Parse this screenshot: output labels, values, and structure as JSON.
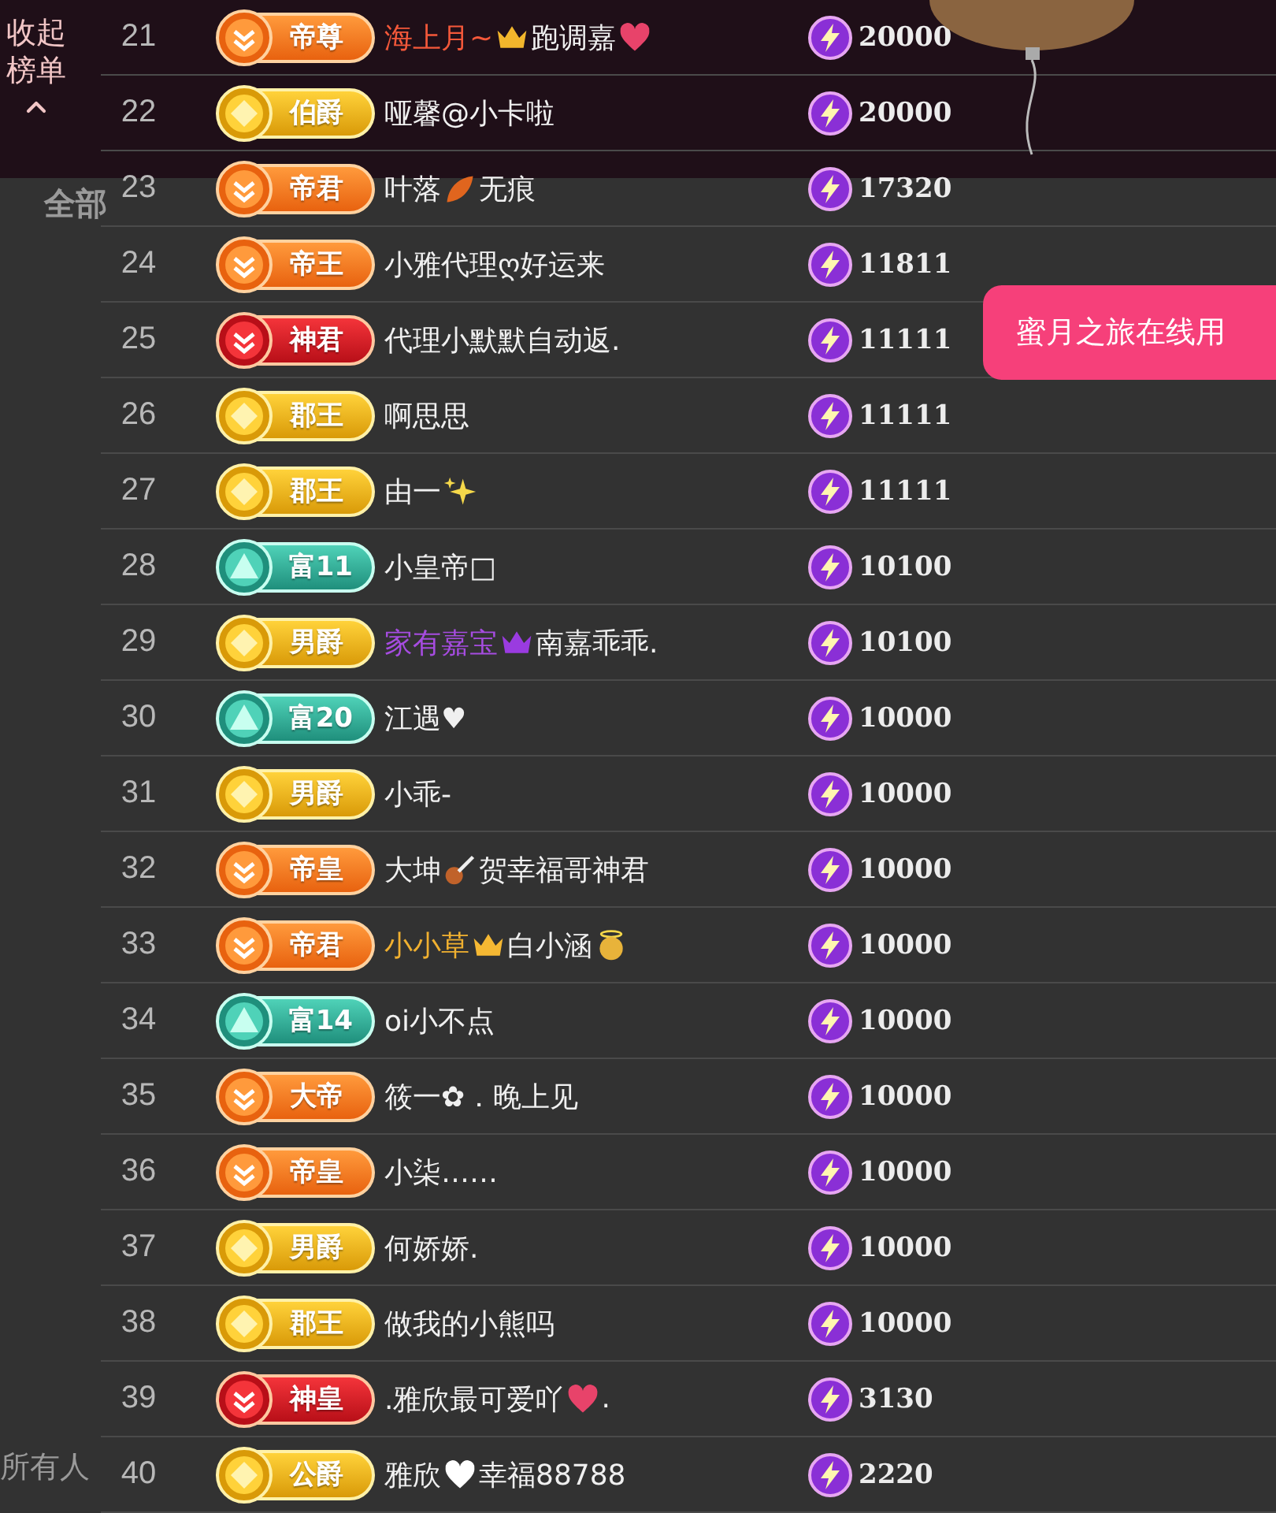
{
  "collapse_button": {
    "label": "收起榜单"
  },
  "background_tab": {
    "label": "全部"
  },
  "background_input": {
    "label": "所有人"
  },
  "toast": {
    "text": "蜜月之旅在线用"
  },
  "rows": [
    {
      "rank": "21",
      "badge": {
        "kind": "orange",
        "label": "帝尊"
      },
      "name": [
        {
          "kind": "text",
          "text": "海上月~",
          "color": "#f4583a"
        },
        {
          "kind": "crown",
          "color": "#f2b62c"
        },
        {
          "kind": "text",
          "text": "跑调嘉"
        },
        {
          "kind": "heart",
          "color": "#e8436a"
        }
      ],
      "score": "20000"
    },
    {
      "rank": "22",
      "badge": {
        "kind": "gold",
        "label": "伯爵"
      },
      "name": [
        {
          "kind": "text",
          "text": "哑馨@小卡啦"
        }
      ],
      "score": "20000"
    },
    {
      "rank": "23",
      "badge": {
        "kind": "orange",
        "label": "帝君"
      },
      "name": [
        {
          "kind": "text",
          "text": "叶落"
        },
        {
          "kind": "leaf",
          "color": "#e0651e"
        },
        {
          "kind": "text",
          "text": "无痕"
        }
      ],
      "score": "17320"
    },
    {
      "rank": "24",
      "badge": {
        "kind": "orange",
        "label": "帝王"
      },
      "name": [
        {
          "kind": "text",
          "text": "小雅代理ღ好运来"
        }
      ],
      "score": "11811"
    },
    {
      "rank": "25",
      "badge": {
        "kind": "red",
        "label": "神君"
      },
      "name": [
        {
          "kind": "text",
          "text": "代理小默默自动返."
        }
      ],
      "score": "11111"
    },
    {
      "rank": "26",
      "badge": {
        "kind": "gold",
        "label": "郡王"
      },
      "name": [
        {
          "kind": "text",
          "text": "啊思思"
        }
      ],
      "score": "11111"
    },
    {
      "rank": "27",
      "badge": {
        "kind": "gold",
        "label": "郡王"
      },
      "name": [
        {
          "kind": "text",
          "text": "由一"
        },
        {
          "kind": "sparkles",
          "color": "#f5d84a"
        }
      ],
      "score": "11111"
    },
    {
      "rank": "28",
      "badge": {
        "kind": "teal",
        "label": "富11"
      },
      "name": [
        {
          "kind": "text",
          "text": "小皇帝□"
        }
      ],
      "score": "10100"
    },
    {
      "rank": "29",
      "badge": {
        "kind": "gold",
        "label": "男爵"
      },
      "name": [
        {
          "kind": "text",
          "text": "家有嘉宝",
          "color": "#a64ce0"
        },
        {
          "kind": "crown",
          "color": "#9a3be0"
        },
        {
          "kind": "text",
          "text": "南嘉乖乖."
        }
      ],
      "score": "10100"
    },
    {
      "rank": "30",
      "badge": {
        "kind": "teal",
        "label": "富20"
      },
      "name": [
        {
          "kind": "text",
          "text": "江遇♥"
        }
      ],
      "score": "10000"
    },
    {
      "rank": "31",
      "badge": {
        "kind": "gold",
        "label": "男爵"
      },
      "name": [
        {
          "kind": "text",
          "text": "小乖-"
        }
      ],
      "score": "10000"
    },
    {
      "rank": "32",
      "badge": {
        "kind": "orange",
        "label": "帝皇"
      },
      "name": [
        {
          "kind": "text",
          "text": "大坤"
        },
        {
          "kind": "guitar",
          "color": "#c0622a"
        },
        {
          "kind": "text",
          "text": "贺幸福哥神君"
        }
      ],
      "score": "10000"
    },
    {
      "rank": "33",
      "badge": {
        "kind": "orange",
        "label": "帝君"
      },
      "name": [
        {
          "kind": "text",
          "text": "小小草",
          "color": "#f0b030"
        },
        {
          "kind": "crown",
          "color": "#f5b833"
        },
        {
          "kind": "text",
          "text": "白小涵"
        },
        {
          "kind": "angel",
          "color": "#e8b33a"
        }
      ],
      "score": "10000"
    },
    {
      "rank": "34",
      "badge": {
        "kind": "teal",
        "label": "富14"
      },
      "name": [
        {
          "kind": "text",
          "text": "oi小不点"
        }
      ],
      "score": "10000"
    },
    {
      "rank": "35",
      "badge": {
        "kind": "orange",
        "label": "大帝"
      },
      "name": [
        {
          "kind": "text",
          "text": "筱一✿．晚上见"
        }
      ],
      "score": "10000"
    },
    {
      "rank": "36",
      "badge": {
        "kind": "orange",
        "label": "帝皇"
      },
      "name": [
        {
          "kind": "text",
          "text": "小柒……"
        }
      ],
      "score": "10000"
    },
    {
      "rank": "37",
      "badge": {
        "kind": "gold",
        "label": "男爵"
      },
      "name": [
        {
          "kind": "text",
          "text": "何娇娇."
        }
      ],
      "score": "10000"
    },
    {
      "rank": "38",
      "badge": {
        "kind": "gold",
        "label": "郡王"
      },
      "name": [
        {
          "kind": "text",
          "text": "做我的小熊吗"
        }
      ],
      "score": "10000"
    },
    {
      "rank": "39",
      "badge": {
        "kind": "red",
        "label": "神皇"
      },
      "name": [
        {
          "kind": "text",
          "text": ".雅欣最可爱吖"
        },
        {
          "kind": "heart",
          "color": "#e8436a"
        },
        {
          "kind": "text",
          "text": "."
        }
      ],
      "score": "3130"
    },
    {
      "rank": "40",
      "badge": {
        "kind": "gold",
        "label": "公爵"
      },
      "name": [
        {
          "kind": "text",
          "text": "雅欣"
        },
        {
          "kind": "heart",
          "color": "#ffffff"
        },
        {
          "kind": "text",
          "text": "幸福88788"
        }
      ],
      "score": "2220"
    }
  ]
}
